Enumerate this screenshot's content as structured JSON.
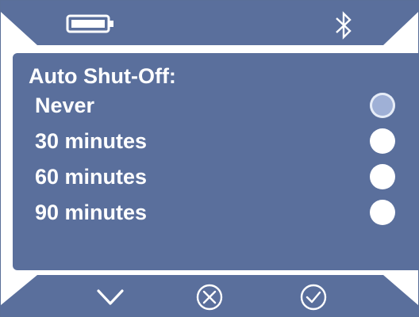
{
  "header": {
    "battery_icon": "battery-icon",
    "bluetooth_icon": "bluetooth-icon"
  },
  "panel": {
    "title": "Auto Shut-Off:",
    "selected_index": 0,
    "options": [
      {
        "label": "Never",
        "selected": true
      },
      {
        "label": "30 minutes",
        "selected": false
      },
      {
        "label": "60 minutes",
        "selected": false
      },
      {
        "label": "90 minutes",
        "selected": false
      }
    ]
  },
  "footer": {
    "icons": [
      "chevron-down-icon",
      "cancel-icon",
      "confirm-icon"
    ]
  },
  "colors": {
    "bar": "#5a6f9c",
    "panel": "#5a6f9c",
    "text": "#ffffff",
    "radio_selected": "#9fb0d6",
    "radio_unselected": "#ffffff"
  }
}
